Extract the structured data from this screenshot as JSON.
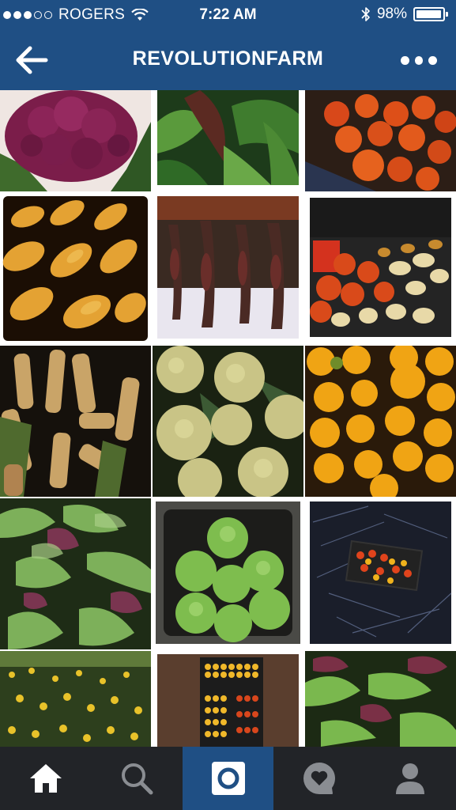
{
  "status_bar": {
    "signal_filled": 3,
    "signal_total": 5,
    "carrier": "ROGERS",
    "time": "7:22 AM",
    "battery_percent": "98%",
    "battery_level": 0.98
  },
  "nav": {
    "title": "REVOLUTIONFARM",
    "back_icon": "arrow-left-icon",
    "more_icon": "more-dots-icon"
  },
  "colors": {
    "brand_blue": "#1f4f84",
    "tab_bar_bg": "#222428",
    "tab_icon": "#8a8d92"
  },
  "grid": {
    "columns": 3,
    "photos": [
      {
        "name": "photo-purple-cauliflower",
        "subject": "purple cauliflower"
      },
      {
        "name": "photo-lettuce-leaves",
        "subject": "lettuce leaves"
      },
      {
        "name": "photo-pumpkins-crate",
        "subject": "orange pumpkins"
      },
      {
        "name": "photo-butternut-squash",
        "subject": "butternut squash"
      },
      {
        "name": "photo-hanging-peppers",
        "subject": "hanging dried peppers"
      },
      {
        "name": "photo-squash-truck",
        "subject": "squash in truck"
      },
      {
        "name": "photo-corn-cobs",
        "subject": "corn cobs"
      },
      {
        "name": "photo-romanesco",
        "subject": "yellow cauliflower"
      },
      {
        "name": "photo-yellow-tomatoes",
        "subject": "yellow tomatoes"
      },
      {
        "name": "photo-salad-greens",
        "subject": "salad greens"
      },
      {
        "name": "photo-cabbages-sink",
        "subject": "cabbages in sink"
      },
      {
        "name": "photo-cherry-tomatoes-grass",
        "subject": "cherry tomatoes on grass"
      },
      {
        "name": "photo-yellow-flowers",
        "subject": "yellow flowers"
      },
      {
        "name": "photo-tomato-trays",
        "subject": "tomato trays"
      },
      {
        "name": "photo-mixed-greens",
        "subject": "mixed greens"
      }
    ]
  },
  "tab_bar": {
    "tabs": [
      {
        "name": "tab-home",
        "icon": "home-icon",
        "active": false
      },
      {
        "name": "tab-search",
        "icon": "search-icon",
        "active": false
      },
      {
        "name": "tab-camera",
        "icon": "camera-icon",
        "active": true
      },
      {
        "name": "tab-activity",
        "icon": "heart-bubble-icon",
        "active": false
      },
      {
        "name": "tab-profile",
        "icon": "profile-icon",
        "active": false
      }
    ]
  }
}
